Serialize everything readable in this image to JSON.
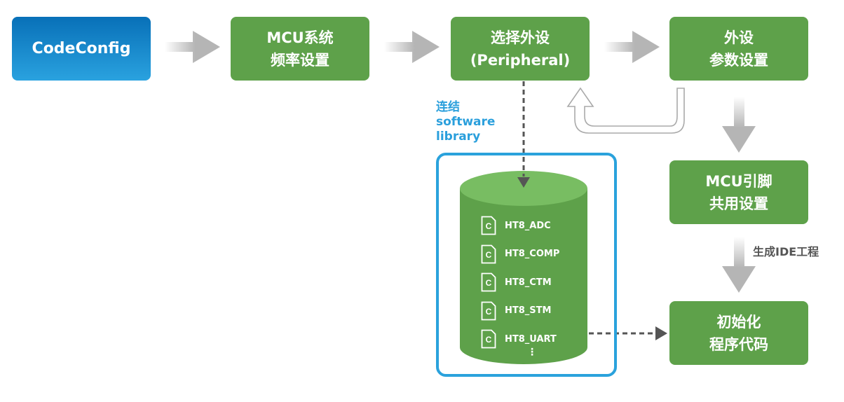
{
  "boxes": {
    "codeconfig": {
      "lines": [
        "CodeConfig"
      ]
    },
    "mcu_freq": {
      "lines": [
        "MCU系统",
        "频率设置"
      ]
    },
    "select_peripheral": {
      "lines": [
        "选择外设",
        "(Peripheral)"
      ]
    },
    "peripheral_params": {
      "lines": [
        "外设",
        "参数设置"
      ]
    },
    "mcu_pin": {
      "lines": [
        "MCU引脚",
        "共用设置"
      ]
    },
    "init_code": {
      "lines": [
        "初始化",
        "程序代码"
      ]
    }
  },
  "library_label": {
    "lines": [
      "连结",
      "software",
      "library"
    ]
  },
  "generate_label": "生成IDE工程",
  "library_files": [
    "HT8_ADC",
    "HT8_COMP",
    "HT8_CTM",
    "HT8_STM",
    "HT8_UART"
  ],
  "file_icon_letter": "C",
  "ellipsis": "⋮",
  "colors": {
    "box_green": "#5ea14a",
    "cylinder_top": "#78bd62",
    "cylinder_body": "#5ea14a",
    "brand_blue": "#2aa2dc",
    "arrow_gray": "#b5b5b5",
    "dashed_arrow": "#555555"
  }
}
